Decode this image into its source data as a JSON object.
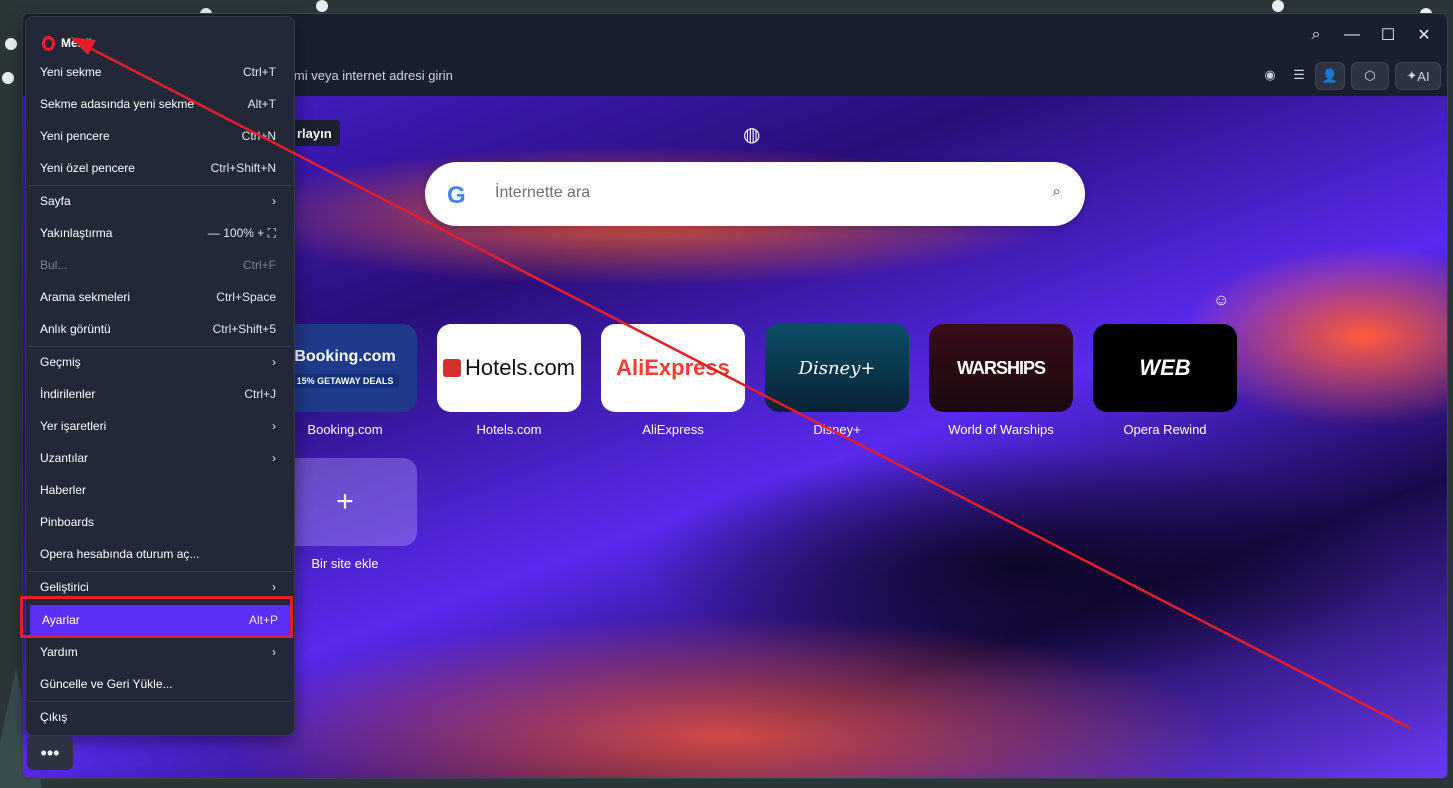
{
  "browser": {
    "address_placeholder_partial": "imi veya internet adresi girin",
    "toolbar_ai_label": "AI"
  },
  "newtab": {
    "tooltip_partial": "rlayın",
    "search_placeholder": "İnternette ara",
    "speed_dials": [
      {
        "label": "Booking.com",
        "tile_text": "Booking.com",
        "tile_badge": "15%  GETAWAY DEALS"
      },
      {
        "label": "Hotels.com",
        "tile_text": "Hotels.com"
      },
      {
        "label": "AliExpress",
        "tile_text": "AliExpress"
      },
      {
        "label": "Disney+",
        "tile_text": "Disney+"
      },
      {
        "label": "World of Warships",
        "tile_text": "WARSHIPS"
      },
      {
        "label": "Opera Rewind",
        "tile_text": "WEB"
      }
    ],
    "add_site_label": "Bir site ekle",
    "add_site_icon": "+"
  },
  "menu": {
    "title": "Menü",
    "items": [
      {
        "label": "Yeni sekme",
        "shortcut": "Ctrl+T"
      },
      {
        "label": "Sekme adasında yeni sekme",
        "shortcut": "Alt+T"
      },
      {
        "label": "Yeni pencere",
        "shortcut": "Ctrl+N"
      },
      {
        "label": "Yeni özel pencere",
        "shortcut": "Ctrl+Shift+N"
      },
      {
        "label": "Sayfa",
        "shortcut": "›"
      },
      {
        "label": "Yakınlaştırma",
        "shortcut": "—  100%  +   ⛶"
      },
      {
        "label": "Bul...",
        "shortcut": "Ctrl+F"
      },
      {
        "label": "Arama sekmeleri",
        "shortcut": "Ctrl+Space"
      },
      {
        "label": "Anlık görüntü",
        "shortcut": "Ctrl+Shift+5"
      },
      {
        "label": "Geçmiş",
        "shortcut": "›"
      },
      {
        "label": "İndirilenler",
        "shortcut": "Ctrl+J"
      },
      {
        "label": "Yer işaretleri",
        "shortcut": "›"
      },
      {
        "label": "Uzantılar",
        "shortcut": "›"
      },
      {
        "label": "Haberler",
        "shortcut": ""
      },
      {
        "label": "Pinboards",
        "shortcut": ""
      },
      {
        "label": "Opera hesabında oturum aç...",
        "shortcut": ""
      },
      {
        "label": "Geliştirici",
        "shortcut": "›"
      },
      {
        "label": "Ayarlar",
        "shortcut": "Alt+P"
      },
      {
        "label": "Yardım",
        "shortcut": "›"
      },
      {
        "label": "Güncelle ve Geri Yükle...",
        "shortcut": ""
      },
      {
        "label": "Çıkış",
        "shortcut": ""
      }
    ],
    "more_button": "•••"
  },
  "colors": {
    "menu_selected": "#5b2ef5",
    "annotation_red": "#e21f2a",
    "opera_red": "#ff1b2d"
  }
}
